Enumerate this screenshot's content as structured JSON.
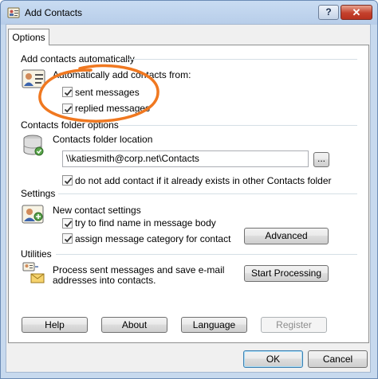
{
  "window": {
    "title": "Add Contacts",
    "help_label": "?",
    "close_label": "✕"
  },
  "tabs": [
    {
      "label": "Options"
    }
  ],
  "sections": {
    "auto": {
      "heading": "Add contacts automatically",
      "label": "Automatically add contacts from:",
      "sent": {
        "label": "sent messages",
        "checked": true
      },
      "replied": {
        "label": "replied messages",
        "checked": true
      }
    },
    "folder": {
      "heading": "Contacts folder options",
      "location_label": "Contacts folder location",
      "location_value": "\\\\katiesmith@corp.net\\Contacts",
      "browse_label": "...",
      "skip_existing": {
        "label": "do not add contact if it already exists in other Contacts folder",
        "checked": true
      }
    },
    "settings": {
      "heading": "Settings",
      "label": "New contact settings",
      "find_name": {
        "label": "try to find name in message body",
        "checked": true
      },
      "assign_category": {
        "label": "assign message category for contact",
        "checked": true
      },
      "advanced_label": "Advanced"
    },
    "utilities": {
      "heading": "Utilities",
      "description_line1": "Process sent messages and save e-mail",
      "description_line2": "addresses into contacts.",
      "start_label": "Start Processing"
    }
  },
  "panel_buttons": {
    "help": "Help",
    "about": "About",
    "language": "Language",
    "register": "Register"
  },
  "dialog_buttons": {
    "ok": "OK",
    "cancel": "Cancel"
  },
  "colors": {
    "annotation": "#f07820",
    "heading_rule": "#d5dfe5"
  },
  "icons": [
    "contact-card-icon",
    "database-icon",
    "users-icon",
    "mail-processing-icon"
  ]
}
